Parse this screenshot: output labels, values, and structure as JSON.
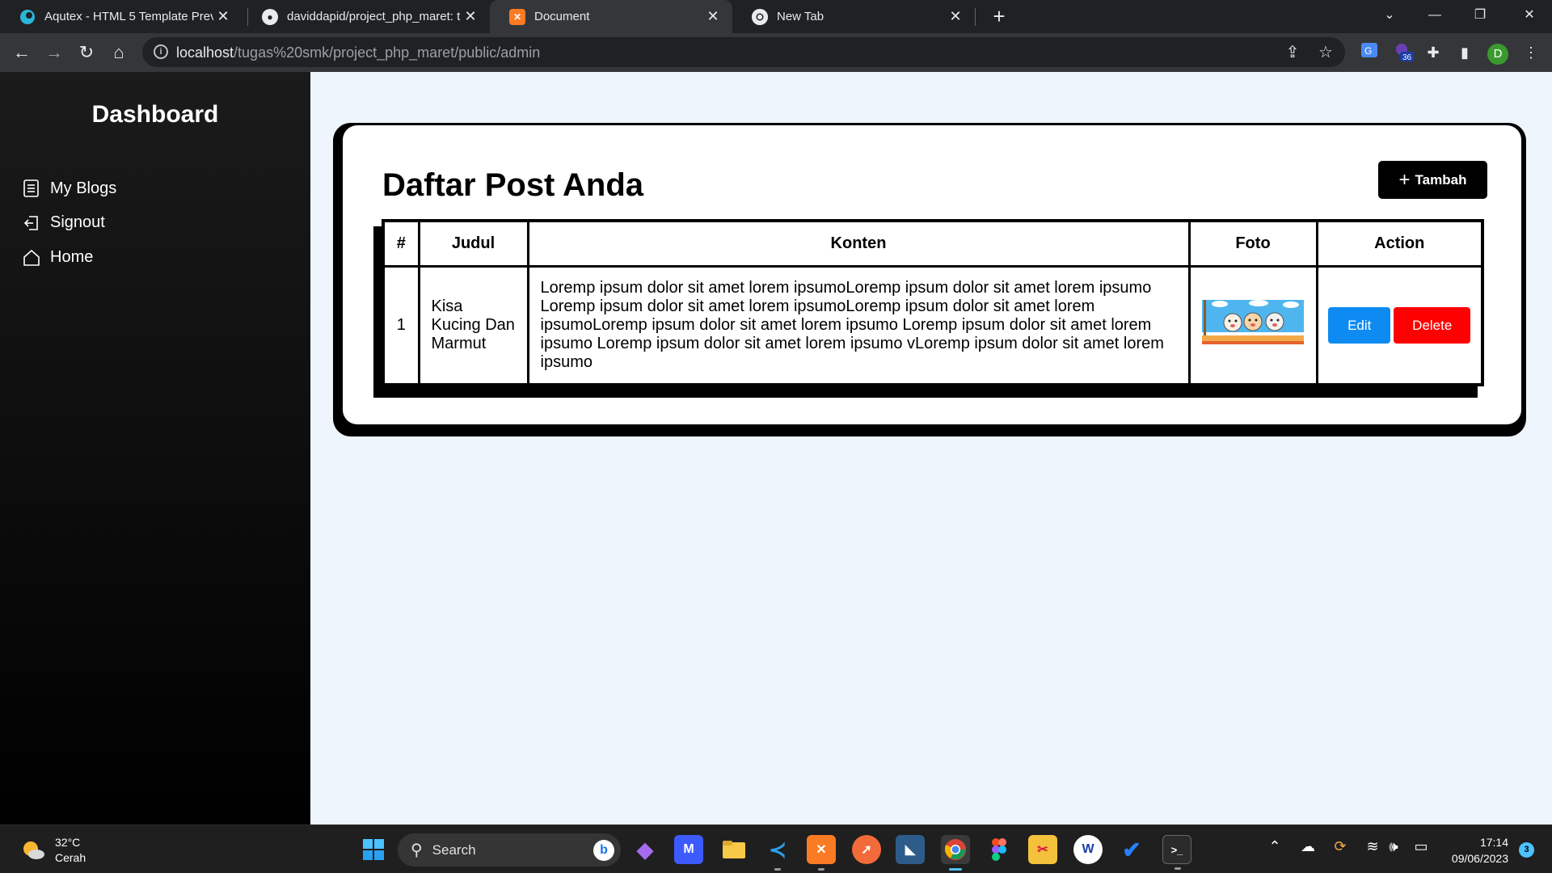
{
  "browser": {
    "tabs": [
      {
        "title": "Aqutex - HTML 5 Template Previe",
        "icon": "aqutex-icon"
      },
      {
        "title": "daviddapid/project_php_maret: t",
        "icon": "github-icon"
      },
      {
        "title": "Document",
        "icon": "xampp-icon"
      },
      {
        "title": "New Tab",
        "icon": "chrome-icon"
      }
    ],
    "url_host": "localhost",
    "url_path": "/tugas%20smk/project_php_maret/public/admin",
    "extension_badge": "36",
    "profile_initial": "D"
  },
  "sidebar": {
    "brand": "Dashboard",
    "items": [
      {
        "label": "My Blogs",
        "icon": "blog-list-icon"
      },
      {
        "label": "Signout",
        "icon": "signout-icon"
      },
      {
        "label": "Home",
        "icon": "home-icon"
      }
    ]
  },
  "main": {
    "title": "Daftar Post Anda",
    "add_button": "Tambah",
    "table": {
      "headers": [
        "#",
        "Judul",
        "Konten",
        "Foto",
        "Action"
      ],
      "rows": [
        {
          "num": "1",
          "judul": "Kisa Kucing Dan Marmut",
          "konten": "Loremp ipsum dolor sit amet lorem ipsumoLoremp ipsum dolor sit amet lorem ipsumo Loremp ipsum dolor sit amet lorem ipsumoLoremp ipsum dolor sit amet lorem ipsumoLoremp ipsum dolor sit amet lorem ipsumo Loremp ipsum dolor sit amet lorem ipsumo Loremp ipsum dolor sit amet lorem ipsumo vLoremp ipsum dolor sit amet lorem ipsumo",
          "edit": "Edit",
          "delete": "Delete"
        }
      ]
    }
  },
  "taskbar": {
    "temperature": "32°C",
    "weather": "Cerah",
    "search_placeholder": "Search",
    "time": "17:14",
    "date": "09/06/2023",
    "notifications": "3"
  },
  "colors": {
    "page_bg": "#eef5fd",
    "edit": "#0d8bf2",
    "delete": "#ff0000",
    "accent": "#000000"
  }
}
